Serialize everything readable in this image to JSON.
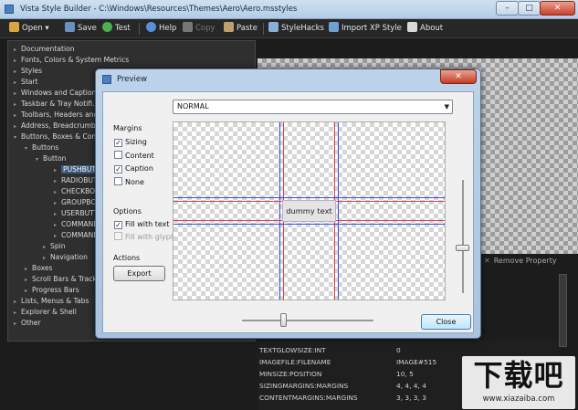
{
  "window": {
    "title": "Vista Style Builder - C:\\Windows\\Resources\\Themes\\Aero\\Aero.msstyles",
    "controls": {
      "minimize": "–",
      "maximize": "□",
      "close": "✕"
    }
  },
  "toolbar": {
    "items": [
      {
        "label": "Open",
        "icon": "folder-icon",
        "color": "#d9a441"
      },
      {
        "label": "Save",
        "icon": "save-icon",
        "color": "#6b8fbf"
      },
      {
        "label": "Test",
        "icon": "play-icon",
        "color": "#4caf50"
      },
      {
        "label": "Help",
        "icon": "help-icon",
        "color": "#5a8fd8"
      },
      {
        "label": "Copy",
        "icon": "copy-icon",
        "color": "#777777"
      },
      {
        "label": "Paste",
        "icon": "paste-icon",
        "color": "#c0a070"
      },
      {
        "label": "StyleHacks",
        "icon": "stylehacks-icon",
        "color": "#8ab0d8"
      },
      {
        "label": "Import XP Style",
        "icon": "import-icon",
        "color": "#6fa0d0"
      },
      {
        "label": "About",
        "icon": "about-icon",
        "color": "#d8d8d8"
      }
    ]
  },
  "tree": {
    "items": [
      {
        "label": "Documentation",
        "expander": "▸"
      },
      {
        "label": "Fonts, Colors & System Metrics",
        "expander": "▸"
      },
      {
        "label": "Styles",
        "expander": "▸"
      },
      {
        "label": "Start",
        "expander": "▸"
      },
      {
        "label": "Windows and Captions",
        "expander": "▸"
      },
      {
        "label": "Taskbar & Tray Notifi...",
        "expander": "▸"
      },
      {
        "label": "Toolbars, Headers and...",
        "expander": "▸"
      },
      {
        "label": "Address, Breadcrumb...",
        "expander": "▸"
      },
      {
        "label": "Buttons, Boxes & Con...",
        "expander": "▾"
      },
      {
        "label": "Buttons",
        "expander": "▾"
      },
      {
        "label": "Button",
        "expander": "▾"
      },
      {
        "label": "PUSHBUTTON",
        "expander": "▸",
        "selected": true
      },
      {
        "label": "RADIOBUTTON",
        "expander": "▸"
      },
      {
        "label": "CHECKBOX",
        "expander": "▸"
      },
      {
        "label": "GROUPBOX",
        "expander": "▸"
      },
      {
        "label": "USERBUTTON",
        "expander": "▸"
      },
      {
        "label": "COMMANDLINK",
        "expander": "▸"
      },
      {
        "label": "COMMANDLINKGLYPH",
        "expander": "▸"
      },
      {
        "label": "Spin",
        "expander": "▸"
      },
      {
        "label": "Navigation",
        "expander": "▸"
      },
      {
        "label": "Boxes",
        "expander": "▸"
      },
      {
        "label": "Scroll Bars & Trackbars",
        "expander": "▸"
      },
      {
        "label": "Progress Bars",
        "expander": "▸"
      },
      {
        "label": "Lists, Menus & Tabs",
        "expander": "▸"
      },
      {
        "label": "Explorer & Shell",
        "expander": "▸"
      },
      {
        "label": "Other",
        "expander": "▸"
      }
    ]
  },
  "right_panel": {
    "remove_property": "Remove Property",
    "properties": [
      {
        "key": "TEXTGLOWSIZE:INT",
        "value": "0"
      },
      {
        "key": "IMAGEFILE:FILENAME",
        "value": "IMAGE#515"
      },
      {
        "key": "MINSIZE:POSITION",
        "value": "10, 5"
      },
      {
        "key": "SIZINGMARGINS:MARGINS",
        "value": "4, 4, 4, 4"
      },
      {
        "key": "CONTENTMARGINS:MARGINS",
        "value": "3, 3, 3, 3"
      }
    ]
  },
  "watermark": {
    "title": "下载吧",
    "url": "www.xiazaiba.com"
  },
  "preview_dialog": {
    "title": "Preview",
    "close_glyph": "✕",
    "state_select": {
      "value": "NORMAL",
      "arrow": "▼"
    },
    "margins": {
      "label": "Margins",
      "options": [
        {
          "label": "Sizing",
          "checked": true
        },
        {
          "label": "Content",
          "checked": false
        },
        {
          "label": "Caption",
          "checked": true
        },
        {
          "label": "None",
          "checked": false
        }
      ]
    },
    "options": {
      "label": "Options",
      "fill_with_text": {
        "label": "Fill with text",
        "checked": true
      },
      "fill_with_glyph": {
        "label": "Fill with glyph",
        "checked": false,
        "disabled": true
      }
    },
    "actions": {
      "label": "Actions",
      "export": "Export"
    },
    "dummy_text": "dummy text",
    "close_button": "Close",
    "check_glyph": "✓"
  }
}
